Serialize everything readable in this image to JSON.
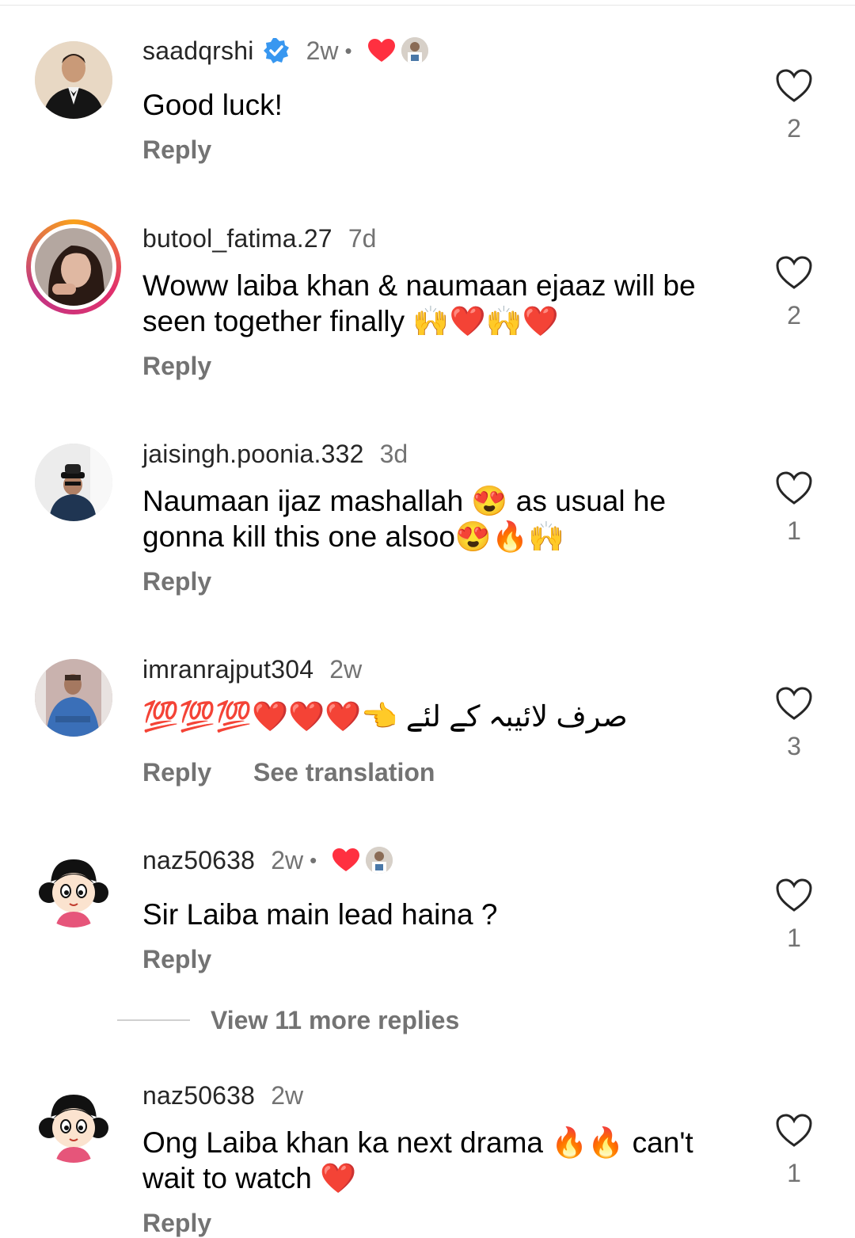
{
  "comments": [
    {
      "username": "saadqrshi",
      "verified": true,
      "time": "2w",
      "liked_by_author": true,
      "text": "Good luck!",
      "reply": "Reply",
      "likes": "2",
      "avatar": "man-in-tuxedo-avatar"
    },
    {
      "username": "butool_fatima.27",
      "verified": false,
      "time": "7d",
      "liked_by_author": false,
      "text": "Woww laiba khan & naumaan ejaaz will be seen together finally 🙌❤️🙌❤️",
      "reply": "Reply",
      "likes": "2",
      "avatar": "woman-portrait-avatar",
      "story_ring": true
    },
    {
      "username": "jaisingh.poonia.332",
      "verified": false,
      "time": "3d",
      "liked_by_author": false,
      "text": "Naumaan ijaz mashallah 😍 as usual he gonna kill this one alsoo😍🔥🙌",
      "reply": "Reply",
      "likes": "1",
      "avatar": "man-with-hat-avatar"
    },
    {
      "username": "imranrajput304",
      "verified": false,
      "time": "2w",
      "liked_by_author": false,
      "text": "💯💯💯❤️❤️❤️👈 صرف لائیبہ کے لئے",
      "reply": "Reply",
      "see_translation": "See translation",
      "likes": "3",
      "avatar": "man-blue-shirt-avatar"
    },
    {
      "username": "naz50638",
      "verified": false,
      "time": "2w",
      "liked_by_author": true,
      "text": "Sir Laiba main lead haina ?",
      "reply": "Reply",
      "likes": "1",
      "avatar": "cartoon-girl-avatar"
    },
    {
      "username": "naz50638",
      "verified": false,
      "time": "2w",
      "liked_by_author": false,
      "text": "Ong Laiba khan ka next drama 🔥🔥 can't wait to watch ❤️",
      "reply": "Reply",
      "likes": "1",
      "avatar": "cartoon-girl-avatar"
    }
  ],
  "view_more_replies": "View 11 more replies",
  "colors": {
    "verified": "#3897f0",
    "heart": "#ff3040",
    "muted": "#737373"
  }
}
